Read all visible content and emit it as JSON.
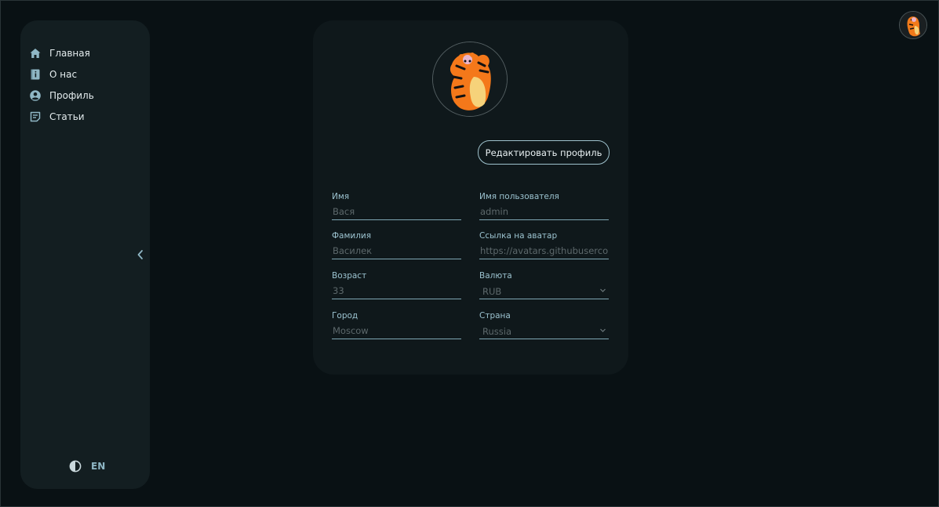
{
  "sidebar": {
    "items": [
      {
        "label": "Главная",
        "icon": "home-icon"
      },
      {
        "label": "О нас",
        "icon": "info-book-icon"
      },
      {
        "label": "Профиль",
        "icon": "user-circle-icon"
      },
      {
        "label": "Статьи",
        "icon": "article-icon"
      }
    ],
    "lang": "EN",
    "theme_icon": "half-circle-icon",
    "collapse_icon": "chevron-left-icon"
  },
  "header": {
    "avatar_icon": "tigger-avatar"
  },
  "profile": {
    "edit_button": "Редактировать профиль",
    "fields": {
      "first_name": {
        "label": "Имя",
        "value": "Вася"
      },
      "last_name": {
        "label": "Фамилия",
        "value": "Василек"
      },
      "age": {
        "label": "Возраст",
        "value": "33"
      },
      "city": {
        "label": "Город",
        "value": "Moscow"
      },
      "username": {
        "label": "Имя пользователя",
        "value": "admin"
      },
      "avatar_url": {
        "label": "Ссылка на аватар",
        "value": "https://avatars.githubusercontent.com"
      },
      "currency": {
        "label": "Валюта",
        "value": "RUB"
      },
      "country": {
        "label": "Страна",
        "value": "Russia"
      }
    }
  },
  "colors": {
    "background": "#091114",
    "sidebar": "#131e21",
    "card": "#0f181b",
    "accent": "#9cc3d0",
    "muted_text": "#5d686b"
  }
}
